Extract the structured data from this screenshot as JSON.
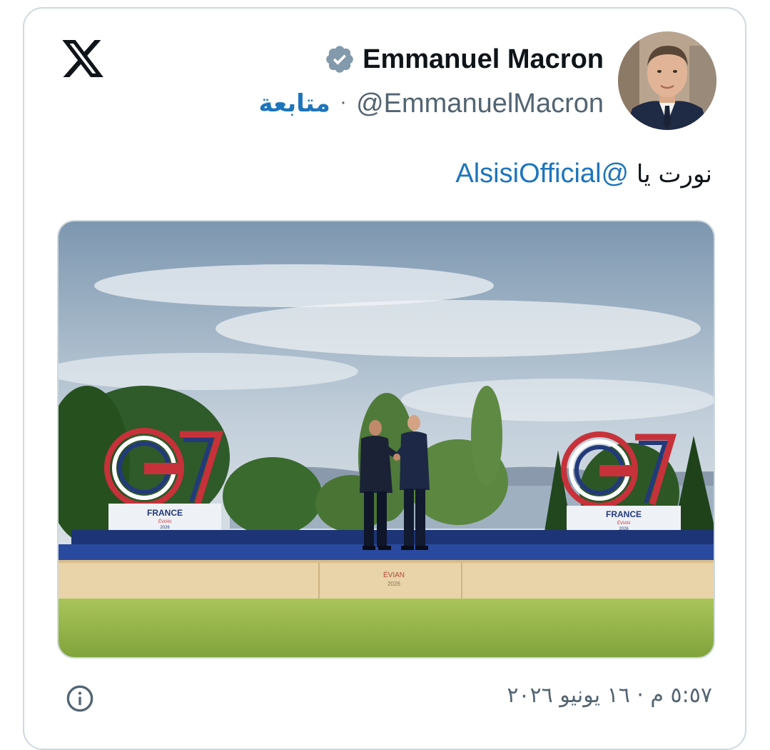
{
  "author": {
    "name": "Emmanuel Macron",
    "handle": "@EmmanuelMacron",
    "separator": "·",
    "follow_label": "متابعة",
    "verified_icon": "verified-badge-icon"
  },
  "tweet": {
    "text_prefix": "نورت يا ",
    "mention": "@AlsisiOfficial"
  },
  "photo": {
    "g7_left": "G7",
    "g7_right": "G7",
    "sign_country": "FRANCE",
    "sign_city": "ÉVIAN",
    "sign_year": "2026",
    "stage_city": "ÉVIAN",
    "stage_year": "2026"
  },
  "footer": {
    "timestamp": "٥:٥٧ م · ١٦ يونيو ٢٠٢٦",
    "info_icon": "info-icon"
  },
  "brand": {
    "logo": "x-logo-icon",
    "accent": "#1d75bd",
    "muted": "#536471"
  }
}
